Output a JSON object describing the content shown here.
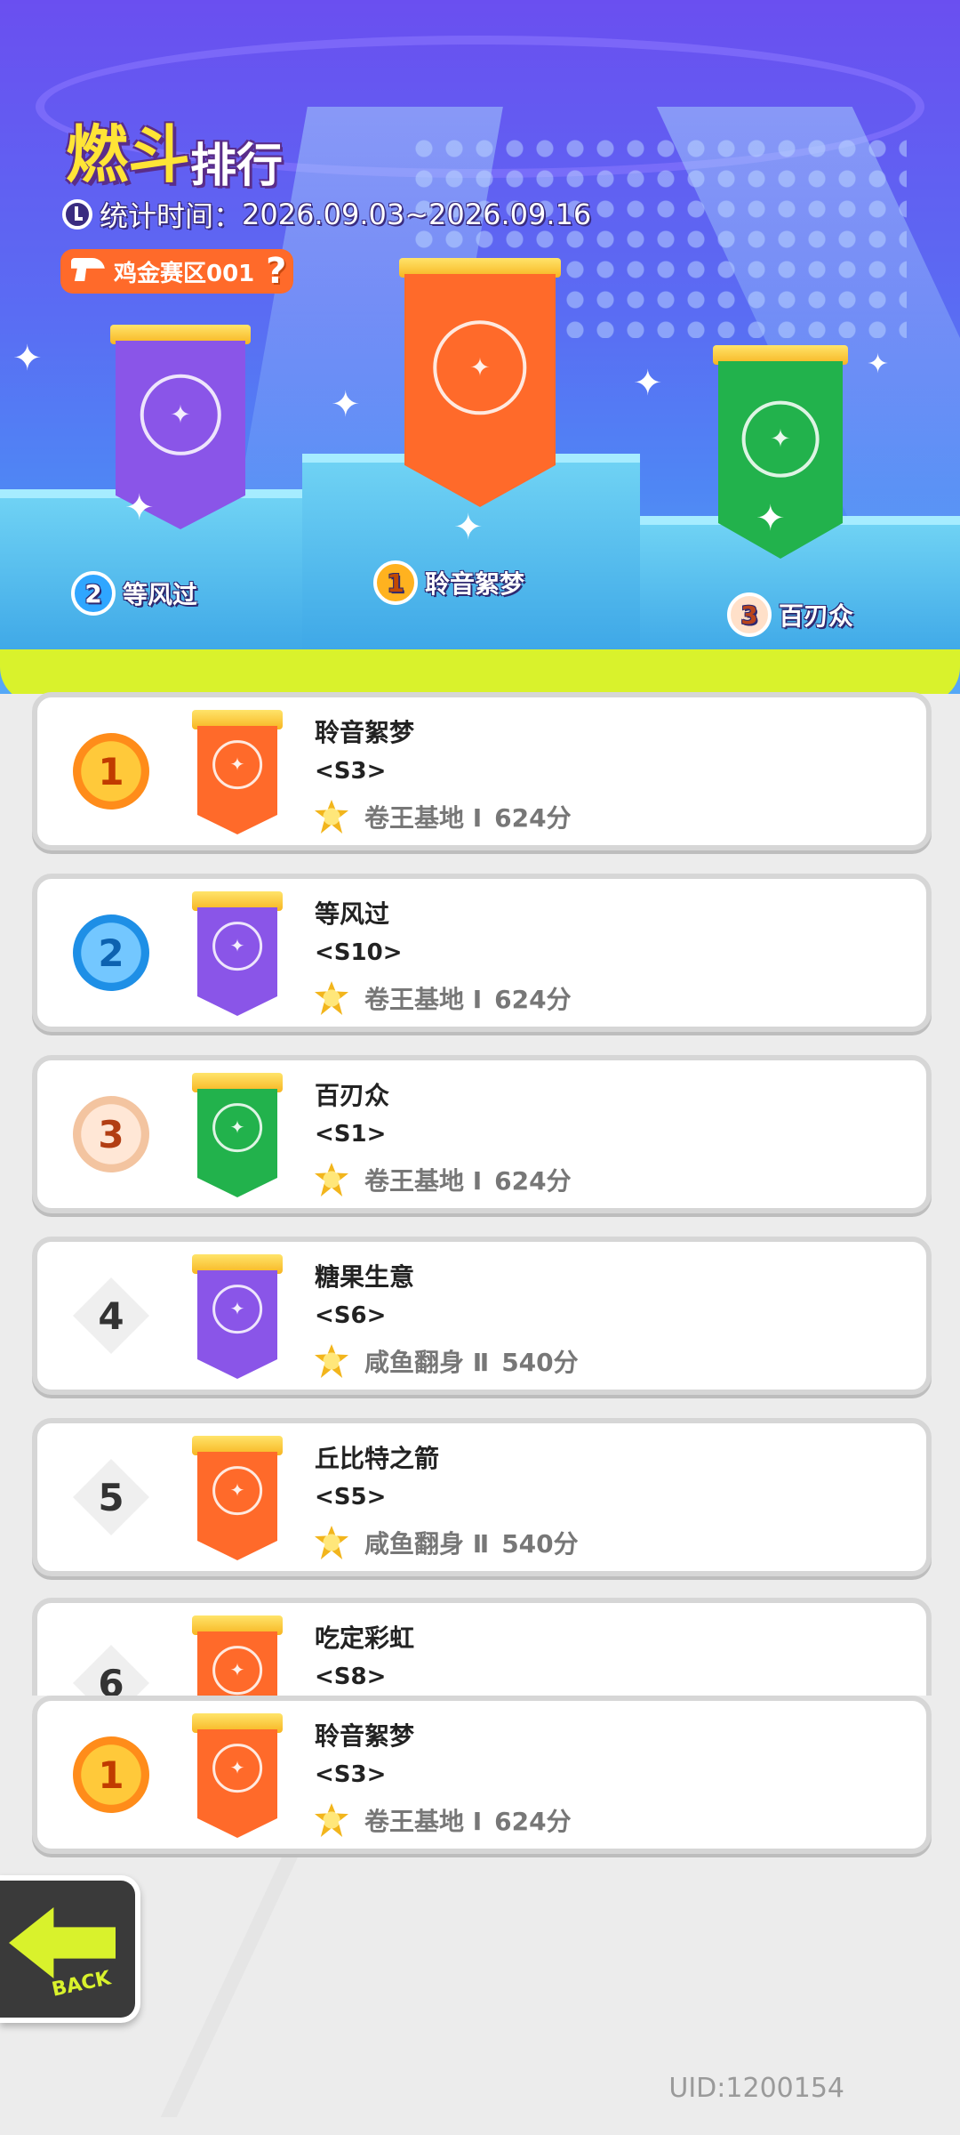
{
  "header": {
    "title_highlight": "燃斗",
    "title_rest": "排行",
    "stat_label": "统计时间：",
    "stat_range": "2026.09.03~2026.09.16",
    "zone_label": "鸡金赛区001",
    "help_glyph": "?"
  },
  "podium": [
    {
      "rank": "2",
      "name": "等风过",
      "banner_color": "#8a55e8"
    },
    {
      "rank": "1",
      "name": "聆音絮梦",
      "banner_color": "#ff6a2a"
    },
    {
      "rank": "3",
      "name": "百刃众",
      "banner_color": "#22b24c"
    }
  ],
  "list": [
    {
      "rank": "1",
      "name": "聆音絮梦",
      "server": "<S3>",
      "tier": "卷王基地 Ⅰ",
      "score": "624分",
      "banner_color": "#ff6a2a"
    },
    {
      "rank": "2",
      "name": "等风过",
      "server": "<S10>",
      "tier": "卷王基地 Ⅰ",
      "score": "624分",
      "banner_color": "#8a55e8"
    },
    {
      "rank": "3",
      "name": "百刃众",
      "server": "<S1>",
      "tier": "卷王基地 Ⅰ",
      "score": "624分",
      "banner_color": "#22b24c"
    },
    {
      "rank": "4",
      "name": "糖果生意",
      "server": "<S6>",
      "tier": "咸鱼翻身 Ⅱ",
      "score": "540分",
      "banner_color": "#8a55e8"
    },
    {
      "rank": "5",
      "name": "丘比特之箭",
      "server": "<S5>",
      "tier": "咸鱼翻身 Ⅱ",
      "score": "540分",
      "banner_color": "#ff6a2a"
    },
    {
      "rank": "6",
      "name": "吃定彩虹",
      "server": "<S8>",
      "tier": "",
      "score": "",
      "banner_color": "#ff6a2a"
    }
  ],
  "my_entry": {
    "rank": "1",
    "name": "聆音絮梦",
    "server": "<S3>",
    "tier": "卷王基地 Ⅰ",
    "score": "624分",
    "banner_color": "#ff6a2a"
  },
  "back_button": {
    "label": "BACK"
  },
  "uid": "UID:1200154",
  "colors": {
    "accent_yellow": "#ffe436",
    "slime": "#d9f22c",
    "zone_orange": "#ff6a2a"
  }
}
